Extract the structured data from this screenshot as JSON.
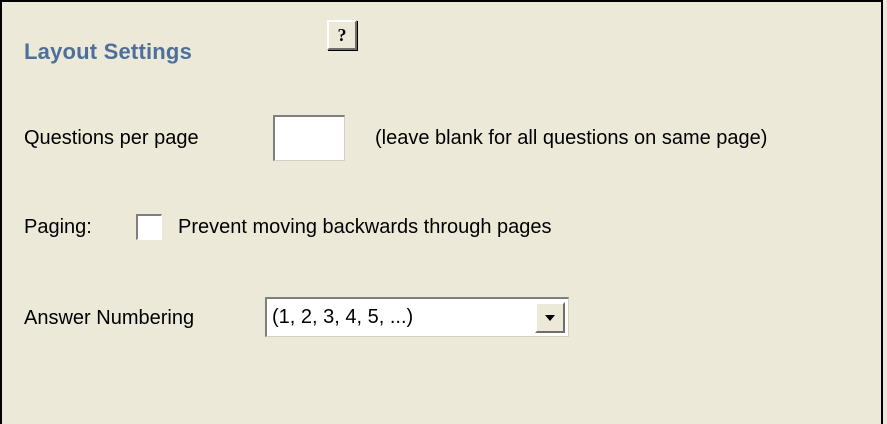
{
  "section": {
    "title": "Layout Settings",
    "help_glyph": "?"
  },
  "questions_per_page": {
    "label": "Questions per page",
    "value": "",
    "hint": "(leave blank for all questions on same page)"
  },
  "paging": {
    "label": "Paging:",
    "checkbox_label": "Prevent moving backwards through pages",
    "checked": false
  },
  "answer_numbering": {
    "label": "Answer Numbering",
    "selected": "(1, 2, 3, 4, 5, ...)"
  },
  "icons": {
    "help": "question-mark-icon",
    "dropdown": "chevron-down-icon"
  },
  "colors": {
    "background": "#ece9d8",
    "title": "#4e6f9a"
  }
}
